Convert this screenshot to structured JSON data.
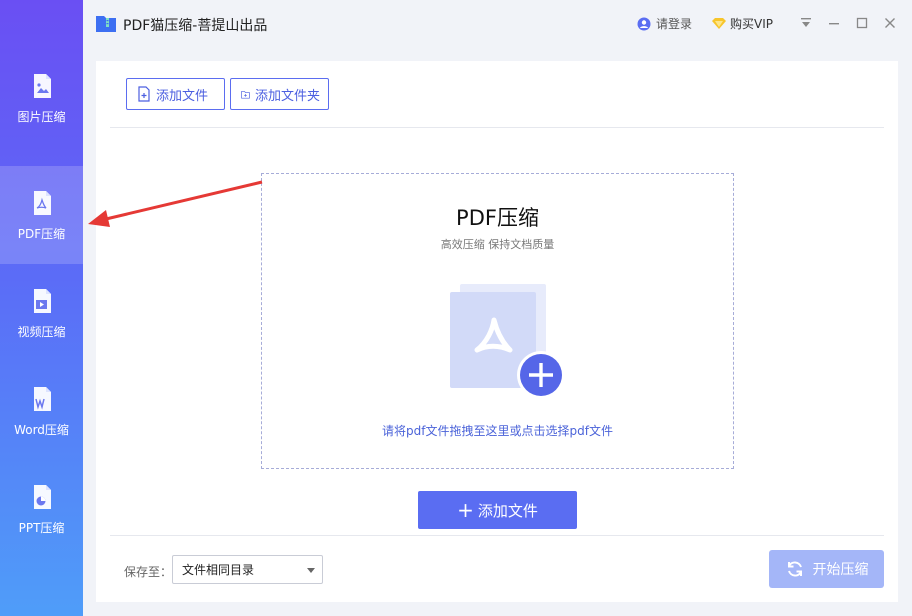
{
  "app": {
    "title": "PDF猫压缩-菩提山出品",
    "login_label": "请登录",
    "vip_label": "购买VIP"
  },
  "sidebar": {
    "items": [
      {
        "label": "图片压缩",
        "icon": "image-file-icon"
      },
      {
        "label": "PDF压缩",
        "icon": "pdf-file-icon",
        "active": true
      },
      {
        "label": "视频压缩",
        "icon": "video-file-icon"
      },
      {
        "label": "Word压缩",
        "icon": "word-file-icon"
      },
      {
        "label": "PPT压缩",
        "icon": "ppt-file-icon"
      }
    ]
  },
  "toolbar": {
    "add_file_label": "添加文件",
    "add_folder_label": "添加文件夹"
  },
  "dropzone": {
    "title": "PDF压缩",
    "subtitle": "高效压缩 保持文档质量",
    "hint": "请将pdf文件拖拽至这里或点击选择pdf文件"
  },
  "add_button_label": "添加文件",
  "footer": {
    "save_label": "保存至：",
    "save_selected": "文件相同目录",
    "start_label": "开始压缩"
  },
  "colors": {
    "accent": "#5a6df2",
    "sidebar_top": "#6a4ff3",
    "sidebar_bottom": "#4f9df9",
    "start_disabled": "#a4b6f8",
    "annotation_arrow": "#e53935"
  }
}
